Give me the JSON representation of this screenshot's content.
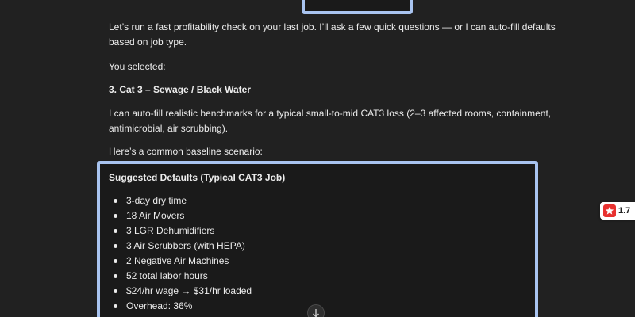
{
  "chat": {
    "intro": "Let’s run a fast profitability check on your last job. I’ll ask a few quick questions — or I can auto-fill defaults",
    "intro_cont": "based on job type.",
    "selected_label": "You selected:",
    "selected_value": "3. Cat 3 – Sewage / Black Water",
    "autofill_line1": "I can auto-fill realistic benchmarks for a typical small-to-mid CAT3 loss (2–3 affected rooms, containment,",
    "autofill_line2": "antimicrobial, air scrubbing).",
    "baseline": "Here’s a common baseline scenario:"
  },
  "defaults": {
    "title": "Suggested Defaults (Typical CAT3 Job)",
    "items": [
      {
        "text": "3-day dry time"
      },
      {
        "text": "18 Air Movers"
      },
      {
        "text": "3 LGR Dehumidifiers"
      },
      {
        "text": "3 Air Scrubbers (with HEPA)"
      },
      {
        "text": "2 Negative Air Machines"
      },
      {
        "text": "52 total labor hours"
      },
      {
        "text": "$24/hr wage → $31/hr loaded"
      },
      {
        "text": "Overhead: 36%"
      }
    ]
  },
  "rating_badge": {
    "value": "1.7",
    "icon": "star-icon",
    "color": "#e8312f"
  },
  "scroll_button": {
    "icon": "arrow-down-icon"
  },
  "colors": {
    "background": "#212121",
    "highlight_border": "#a9c4f0",
    "text": "#ececec"
  }
}
